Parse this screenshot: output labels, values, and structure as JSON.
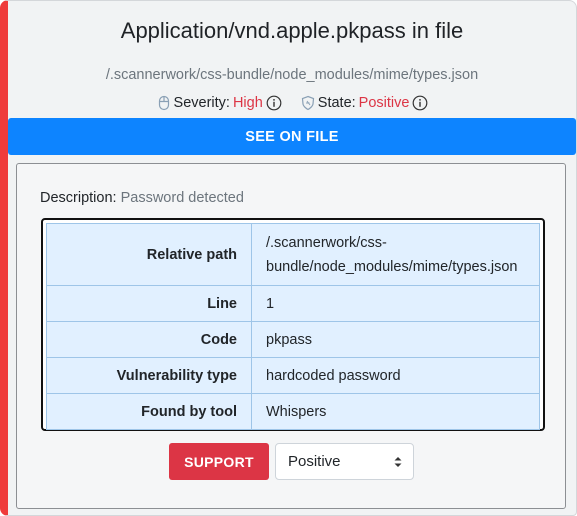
{
  "header": {
    "title": "Application/vnd.apple.pkpass in file",
    "file_path": "/.scannerwork/css-bundle/node_modules/mime/types.json",
    "severity_label": "Severity:",
    "severity_value": "High",
    "state_label": "State:",
    "state_value": "Positive"
  },
  "see_on_file_label": "SEE ON FILE",
  "description": {
    "label": "Description:",
    "value": "Password detected"
  },
  "details": {
    "rows": [
      {
        "label": "Relative path",
        "value_line1": "/.scannerwork/css-",
        "value_line2": "bundle/node_modules/mime/types.json"
      },
      {
        "label": "Line",
        "value": "1"
      },
      {
        "label": "Code",
        "value": "pkpass"
      },
      {
        "label": "Vulnerability type",
        "value": "hardcoded password"
      },
      {
        "label": "Found by tool",
        "value": "Whispers"
      }
    ]
  },
  "actions": {
    "support_label": "SUPPORT",
    "state_select_value": "Positive"
  },
  "colors": {
    "accent_bar": "#ef3b3b",
    "primary_button": "#0d84ff",
    "danger": "#dc3545",
    "table_cell_bg": "#e1f0ff"
  }
}
